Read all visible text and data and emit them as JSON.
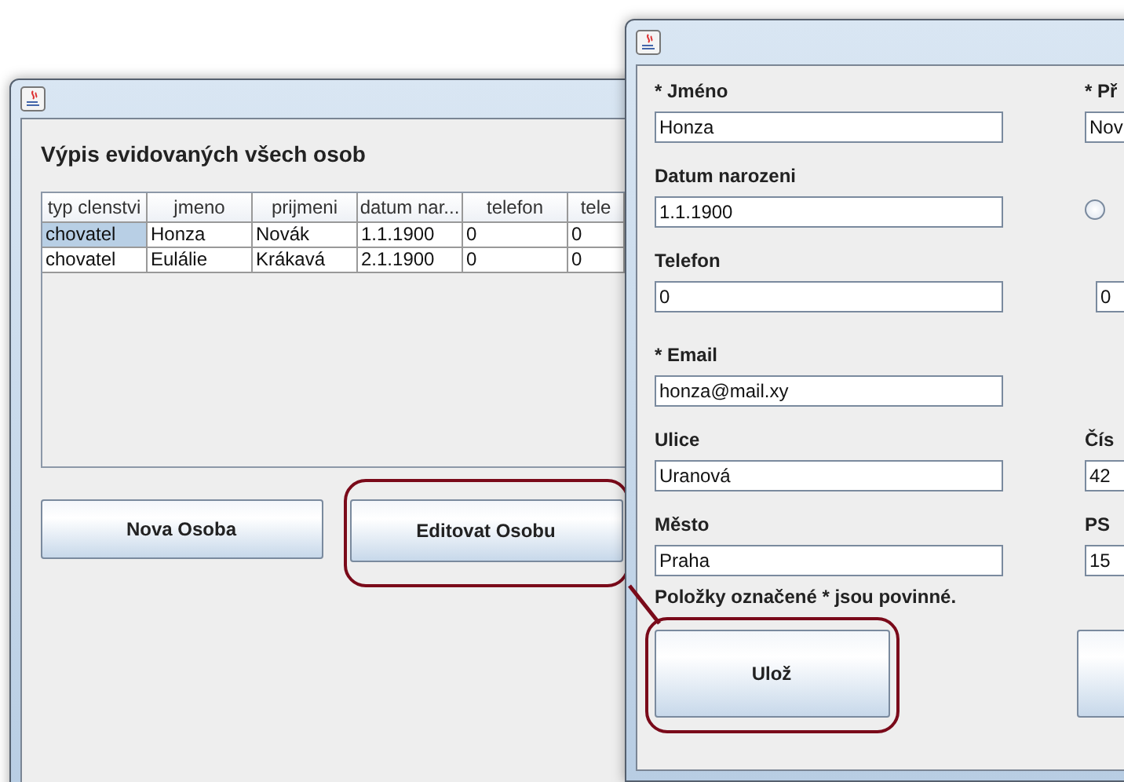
{
  "list_window": {
    "heading": "Výpis evidovaných všech osob",
    "table": {
      "columns": [
        "typ clenstvi",
        "jmeno",
        "prijmeni",
        "datum nar...",
        "telefon",
        "tele"
      ],
      "rows": [
        {
          "cells": [
            {
              "text": "chovatel",
              "selected": true
            },
            {
              "text": "Honza",
              "selected": false
            },
            {
              "text": "Novák",
              "selected": false
            },
            {
              "text": "1.1.1900",
              "selected": false
            },
            {
              "text": "0",
              "selected": false
            },
            {
              "text": "0",
              "selected": false
            }
          ]
        },
        {
          "cells": [
            {
              "text": "chovatel",
              "selected": false
            },
            {
              "text": "Eulálie",
              "selected": false
            },
            {
              "text": "Krákavá",
              "selected": false
            },
            {
              "text": "2.1.1900",
              "selected": false
            },
            {
              "text": "0",
              "selected": false
            },
            {
              "text": "0",
              "selected": false
            }
          ]
        }
      ]
    },
    "buttons": [
      {
        "label": "Nova Osoba",
        "highlighted": false
      },
      {
        "label": "Editovat Osobu",
        "highlighted": true
      }
    ]
  },
  "form_window": {
    "rows": [
      {
        "left": {
          "kind": "field",
          "label": "* Jméno",
          "value": "Honza"
        },
        "right": {
          "kind": "field",
          "label": "* Př",
          "value": "Nov"
        }
      },
      {
        "left": {
          "kind": "field",
          "label": "Datum narozeni",
          "value": "1.1.1900"
        },
        "right": {
          "kind": "radio",
          "selected": false
        }
      },
      {
        "left": {
          "kind": "field",
          "label": "Telefon",
          "value": "0"
        },
        "right": {
          "kind": "field",
          "value": "0"
        }
      },
      {
        "left": {
          "kind": "field",
          "label": "* Email",
          "value": "honza@mail.xy"
        }
      },
      {
        "left": {
          "kind": "field",
          "label": "Ulice",
          "value": "Uranová"
        },
        "right": {
          "kind": "field",
          "label": "Čís",
          "value": "42"
        }
      },
      {
        "left": {
          "kind": "field",
          "label": "Město",
          "value": "Praha"
        },
        "right": {
          "kind": "field",
          "label": "PS",
          "value": "15"
        }
      }
    ],
    "note": "Položky označené * jsou povinné.",
    "buttons": [
      {
        "label": "Ulož",
        "highlighted": true
      },
      {
        "highlighted": false
      }
    ]
  }
}
